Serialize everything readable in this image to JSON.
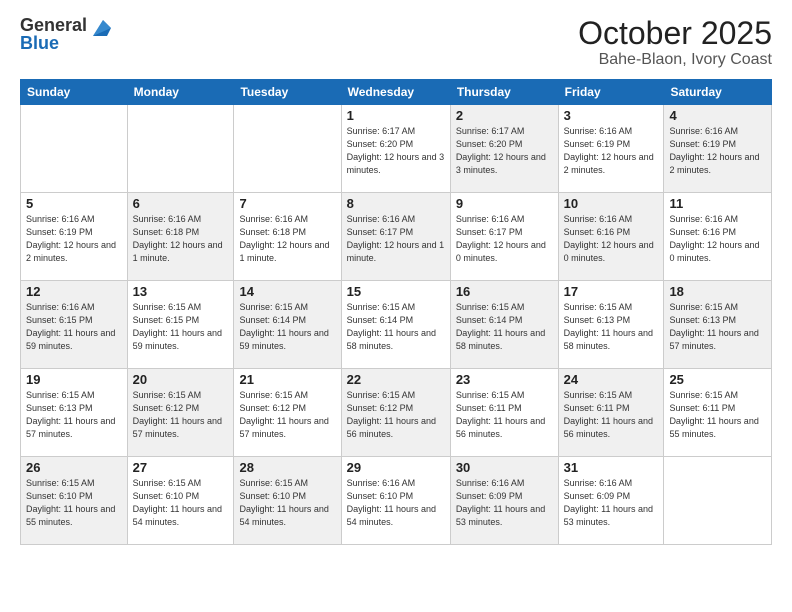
{
  "logo": {
    "general": "General",
    "blue": "Blue"
  },
  "header": {
    "month": "October 2025",
    "location": "Bahe-Blaon, Ivory Coast"
  },
  "weekdays": [
    "Sunday",
    "Monday",
    "Tuesday",
    "Wednesday",
    "Thursday",
    "Friday",
    "Saturday"
  ],
  "weeks": [
    [
      {
        "day": "",
        "info": ""
      },
      {
        "day": "",
        "info": ""
      },
      {
        "day": "",
        "info": ""
      },
      {
        "day": "1",
        "info": "Sunrise: 6:17 AM\nSunset: 6:20 PM\nDaylight: 12 hours and 3 minutes."
      },
      {
        "day": "2",
        "info": "Sunrise: 6:17 AM\nSunset: 6:20 PM\nDaylight: 12 hours and 3 minutes."
      },
      {
        "day": "3",
        "info": "Sunrise: 6:16 AM\nSunset: 6:19 PM\nDaylight: 12 hours and 2 minutes."
      },
      {
        "day": "4",
        "info": "Sunrise: 6:16 AM\nSunset: 6:19 PM\nDaylight: 12 hours and 2 minutes."
      }
    ],
    [
      {
        "day": "5",
        "info": "Sunrise: 6:16 AM\nSunset: 6:19 PM\nDaylight: 12 hours and 2 minutes."
      },
      {
        "day": "6",
        "info": "Sunrise: 6:16 AM\nSunset: 6:18 PM\nDaylight: 12 hours and 1 minute."
      },
      {
        "day": "7",
        "info": "Sunrise: 6:16 AM\nSunset: 6:18 PM\nDaylight: 12 hours and 1 minute."
      },
      {
        "day": "8",
        "info": "Sunrise: 6:16 AM\nSunset: 6:17 PM\nDaylight: 12 hours and 1 minute."
      },
      {
        "day": "9",
        "info": "Sunrise: 6:16 AM\nSunset: 6:17 PM\nDaylight: 12 hours and 0 minutes."
      },
      {
        "day": "10",
        "info": "Sunrise: 6:16 AM\nSunset: 6:16 PM\nDaylight: 12 hours and 0 minutes."
      },
      {
        "day": "11",
        "info": "Sunrise: 6:16 AM\nSunset: 6:16 PM\nDaylight: 12 hours and 0 minutes."
      }
    ],
    [
      {
        "day": "12",
        "info": "Sunrise: 6:16 AM\nSunset: 6:15 PM\nDaylight: 11 hours and 59 minutes."
      },
      {
        "day": "13",
        "info": "Sunrise: 6:15 AM\nSunset: 6:15 PM\nDaylight: 11 hours and 59 minutes."
      },
      {
        "day": "14",
        "info": "Sunrise: 6:15 AM\nSunset: 6:14 PM\nDaylight: 11 hours and 59 minutes."
      },
      {
        "day": "15",
        "info": "Sunrise: 6:15 AM\nSunset: 6:14 PM\nDaylight: 11 hours and 58 minutes."
      },
      {
        "day": "16",
        "info": "Sunrise: 6:15 AM\nSunset: 6:14 PM\nDaylight: 11 hours and 58 minutes."
      },
      {
        "day": "17",
        "info": "Sunrise: 6:15 AM\nSunset: 6:13 PM\nDaylight: 11 hours and 58 minutes."
      },
      {
        "day": "18",
        "info": "Sunrise: 6:15 AM\nSunset: 6:13 PM\nDaylight: 11 hours and 57 minutes."
      }
    ],
    [
      {
        "day": "19",
        "info": "Sunrise: 6:15 AM\nSunset: 6:13 PM\nDaylight: 11 hours and 57 minutes."
      },
      {
        "day": "20",
        "info": "Sunrise: 6:15 AM\nSunset: 6:12 PM\nDaylight: 11 hours and 57 minutes."
      },
      {
        "day": "21",
        "info": "Sunrise: 6:15 AM\nSunset: 6:12 PM\nDaylight: 11 hours and 57 minutes."
      },
      {
        "day": "22",
        "info": "Sunrise: 6:15 AM\nSunset: 6:12 PM\nDaylight: 11 hours and 56 minutes."
      },
      {
        "day": "23",
        "info": "Sunrise: 6:15 AM\nSunset: 6:11 PM\nDaylight: 11 hours and 56 minutes."
      },
      {
        "day": "24",
        "info": "Sunrise: 6:15 AM\nSunset: 6:11 PM\nDaylight: 11 hours and 56 minutes."
      },
      {
        "day": "25",
        "info": "Sunrise: 6:15 AM\nSunset: 6:11 PM\nDaylight: 11 hours and 55 minutes."
      }
    ],
    [
      {
        "day": "26",
        "info": "Sunrise: 6:15 AM\nSunset: 6:10 PM\nDaylight: 11 hours and 55 minutes."
      },
      {
        "day": "27",
        "info": "Sunrise: 6:15 AM\nSunset: 6:10 PM\nDaylight: 11 hours and 54 minutes."
      },
      {
        "day": "28",
        "info": "Sunrise: 6:15 AM\nSunset: 6:10 PM\nDaylight: 11 hours and 54 minutes."
      },
      {
        "day": "29",
        "info": "Sunrise: 6:16 AM\nSunset: 6:10 PM\nDaylight: 11 hours and 54 minutes."
      },
      {
        "day": "30",
        "info": "Sunrise: 6:16 AM\nSunset: 6:09 PM\nDaylight: 11 hours and 53 minutes."
      },
      {
        "day": "31",
        "info": "Sunrise: 6:16 AM\nSunset: 6:09 PM\nDaylight: 11 hours and 53 minutes."
      },
      {
        "day": "",
        "info": ""
      }
    ]
  ]
}
